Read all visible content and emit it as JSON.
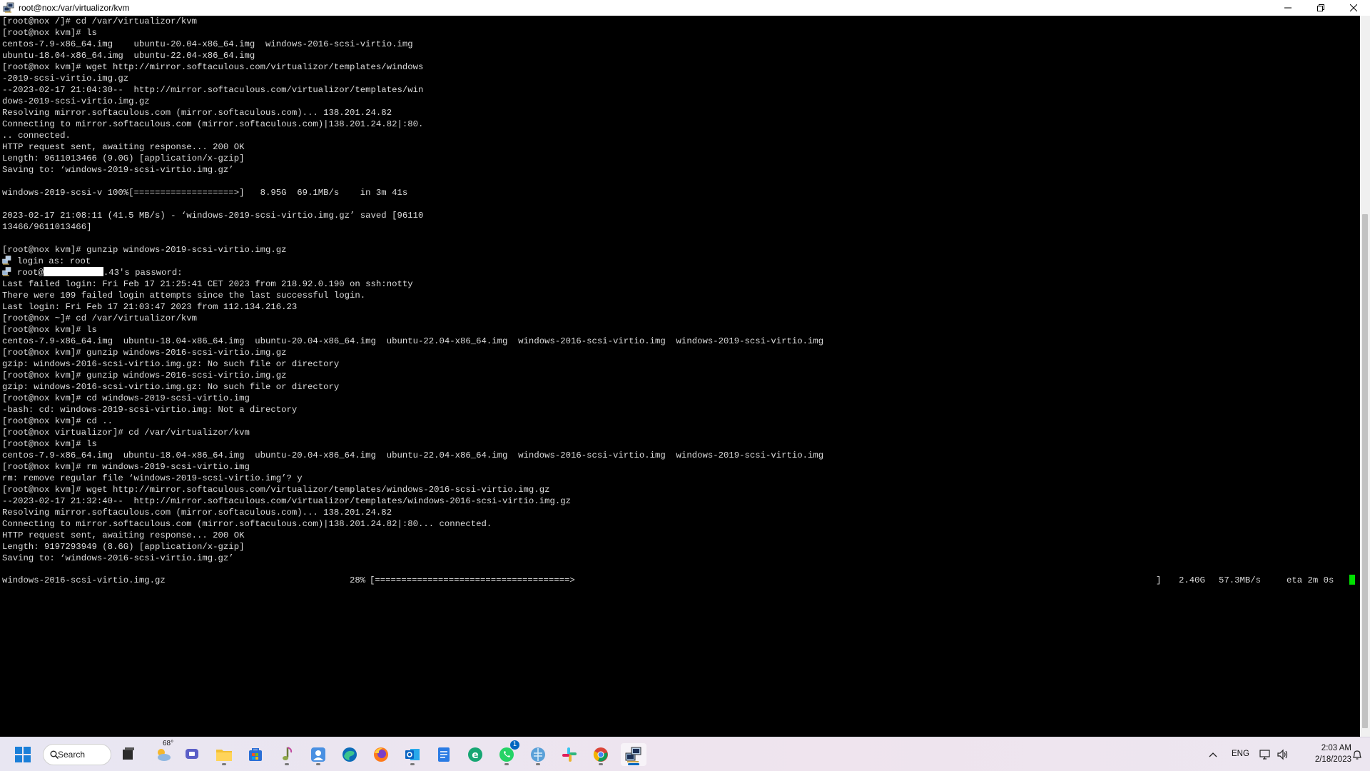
{
  "window": {
    "title": "root@nox:/var/virtualizor/kvm",
    "minimize": "—",
    "restore": "❐",
    "close": "✕"
  },
  "terminal": {
    "lines": [
      "[root@nox /]# cd /var/virtualizor/kvm",
      "[root@nox kvm]# ls",
      "centos-7.9-x86_64.img    ubuntu-20.04-x86_64.img  windows-2016-scsi-virtio.img",
      "ubuntu-18.04-x86_64.img  ubuntu-22.04-x86_64.img",
      "[root@nox kvm]# wget http://mirror.softaculous.com/virtualizor/templates/windows",
      "-2019-scsi-virtio.img.gz",
      "--2023-02-17 21:04:30--  http://mirror.softaculous.com/virtualizor/templates/win",
      "dows-2019-scsi-virtio.img.gz",
      "Resolving mirror.softaculous.com (mirror.softaculous.com)... 138.201.24.82",
      "Connecting to mirror.softaculous.com (mirror.softaculous.com)|138.201.24.82|:80.",
      ".. connected.",
      "HTTP request sent, awaiting response... 200 OK",
      "Length: 9611013466 (9.0G) [application/x-gzip]",
      "Saving to: ‘windows-2019-scsi-virtio.img.gz’",
      "",
      "windows-2019-scsi-v 100%[===================>]   8.95G  69.1MB/s    in 3m 41s",
      "",
      "2023-02-17 21:08:11 (41.5 MB/s) - ‘windows-2019-scsi-virtio.img.gz’ saved [96110",
      "13466/9611013466]",
      "",
      "[root@nox kvm]# gunzip windows-2019-scsi-virtio.img.gz",
      "login as: root",
      "REDACTED",
      "Last failed login: Fri Feb 17 21:25:41 CET 2023 from 218.92.0.190 on ssh:notty",
      "There were 109 failed login attempts since the last successful login.",
      "Last login: Fri Feb 17 21:03:47 2023 from 112.134.216.23",
      "[root@nox ~]# cd /var/virtualizor/kvm",
      "[root@nox kvm]# ls",
      "centos-7.9-x86_64.img  ubuntu-18.04-x86_64.img  ubuntu-20.04-x86_64.img  ubuntu-22.04-x86_64.img  windows-2016-scsi-virtio.img  windows-2019-scsi-virtio.img",
      "[root@nox kvm]# gunzip windows-2016-scsi-virtio.img.gz",
      "gzip: windows-2016-scsi-virtio.img.gz: No such file or directory",
      "[root@nox kvm]# gunzip windows-2016-scsi-virtio.img.gz",
      "gzip: windows-2016-scsi-virtio.img.gz: No such file or directory",
      "[root@nox kvm]# cd windows-2019-scsi-virtio.img",
      "-bash: cd: windows-2019-scsi-virtio.img: Not a directory",
      "[root@nox kvm]# cd ..",
      "[root@nox virtualizor]# cd /var/virtualizor/kvm",
      "[root@nox kvm]# ls",
      "centos-7.9-x86_64.img  ubuntu-18.04-x86_64.img  ubuntu-20.04-x86_64.img  ubuntu-22.04-x86_64.img  windows-2016-scsi-virtio.img  windows-2019-scsi-virtio.img",
      "[root@nox kvm]# rm windows-2019-scsi-virtio.img",
      "rm: remove regular file ‘windows-2019-scsi-virtio.img’? y",
      "[root@nox kvm]# wget http://mirror.softaculous.com/virtualizor/templates/windows-2016-scsi-virtio.img.gz",
      "--2023-02-17 21:32:40--  http://mirror.softaculous.com/virtualizor/templates/windows-2016-scsi-virtio.img.gz",
      "Resolving mirror.softaculous.com (mirror.softaculous.com)... 138.201.24.82",
      "Connecting to mirror.softaculous.com (mirror.softaculous.com)|138.201.24.82|:80... connected.",
      "HTTP request sent, awaiting response... 200 OK",
      "Length: 9197293949 (8.6G) [application/x-gzip]",
      "Saving to: ‘windows-2016-scsi-virtio.img.gz’",
      ""
    ],
    "password_prompt": {
      "prefix": "root@",
      "suffix": ".43's password:"
    },
    "progress": {
      "filename": "windows-2016-scsi-virtio.img.gz",
      "percent_text": "28%",
      "bar": "[=====================================>",
      "bar_end": "]",
      "size": "2.40G",
      "rate": "57.3MB/s",
      "eta": "eta 2m 0s",
      "percent": 28
    }
  },
  "taskbar": {
    "search_label": "Search",
    "weather_temp": "68°",
    "whatsapp_badge": "1",
    "language": "ENG",
    "time": "2:03 AM",
    "date": "2/18/2023",
    "apps": [
      {
        "name": "start-button-icon"
      },
      {
        "name": "task-view-icon"
      },
      {
        "name": "weather-widget-icon"
      },
      {
        "name": "teams-chat-icon"
      },
      {
        "name": "file-explorer-icon"
      },
      {
        "name": "microsoft-store-icon"
      },
      {
        "name": "audio-app-icon"
      },
      {
        "name": "contacts-app-icon"
      },
      {
        "name": "edge-icon"
      },
      {
        "name": "firefox-icon"
      },
      {
        "name": "outlook-icon"
      },
      {
        "name": "notepad-icon"
      },
      {
        "name": "edge-alt-icon"
      },
      {
        "name": "whatsapp-icon"
      },
      {
        "name": "network-app-icon"
      },
      {
        "name": "slack-icon"
      },
      {
        "name": "chrome-icon"
      },
      {
        "name": "putty-icon"
      }
    ]
  }
}
